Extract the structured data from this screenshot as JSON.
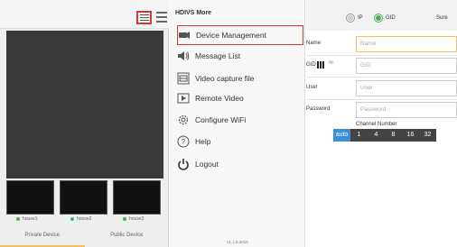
{
  "left": {
    "thumbs": [
      {
        "label": "house1"
      },
      {
        "label": "house2"
      },
      {
        "label": "house3"
      }
    ],
    "tabs": [
      "Private Device",
      "Public Device"
    ]
  },
  "menu": {
    "title": "HDIVS  More",
    "items": [
      {
        "label": "Device Management",
        "icon": "camera-icon",
        "selected": true
      },
      {
        "label": "Message List",
        "icon": "speaker-icon",
        "selected": false
      },
      {
        "label": "Video capture file",
        "icon": "video-file-icon",
        "selected": false
      },
      {
        "label": "Remote Video",
        "icon": "play-icon",
        "selected": false
      },
      {
        "label": "Configure WiFi",
        "icon": "gear-icon",
        "selected": false
      },
      {
        "label": "Help",
        "icon": "help-icon",
        "selected": false
      },
      {
        "label": "Logout",
        "icon": "power-icon",
        "selected": false
      }
    ],
    "version": "v1.1.6.2015"
  },
  "form": {
    "mode_options": [
      "IP",
      "GID"
    ],
    "mode_selected": "GID",
    "sure_label": "Sure",
    "fields": [
      {
        "label": "Name",
        "placeholder": "Name"
      },
      {
        "label": "GID",
        "placeholder": "GID"
      },
      {
        "label": "User",
        "placeholder": "User"
      },
      {
        "label": "Password",
        "placeholder": "Password"
      }
    ],
    "channel_label": "Channel Number",
    "channel_options": [
      "auto",
      "1",
      "4",
      "8",
      "16",
      "32"
    ],
    "channel_selected": "auto"
  },
  "colors": {
    "highlight_red": "#d93636",
    "accent_blue": "#3a8fd9",
    "status_green": "#4caf50"
  }
}
